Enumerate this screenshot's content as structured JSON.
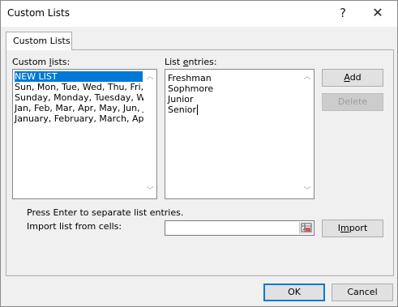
{
  "window": {
    "title": "Custom Lists",
    "help_glyph": "?",
    "close_glyph": "✕"
  },
  "tab": {
    "label": "Custom Lists"
  },
  "custom_lists": {
    "label_pre": "Custom ",
    "label_accel": "l",
    "label_post": "ists:",
    "items": [
      {
        "label": "NEW LIST",
        "selected": true
      },
      {
        "label": "Sun, Mon, Tue, Wed, Thu, Fri, S"
      },
      {
        "label": "Sunday, Monday, Tuesday, We"
      },
      {
        "label": "Jan, Feb, Mar, Apr, May, Jun, Ju"
      },
      {
        "label": "January, February, March, Apri"
      }
    ]
  },
  "list_entries": {
    "label_pre": "List ",
    "label_accel": "e",
    "label_post": "ntries:",
    "lines": [
      "Freshman",
      "Sophmore",
      "Junior",
      "Senior"
    ]
  },
  "buttons": {
    "add_accel": "A",
    "add_rest": "dd",
    "delete_label": "Delete",
    "import_pre": "I",
    "import_accel": "m",
    "import_post": "port",
    "ok_label": "OK",
    "cancel_label": "Cancel"
  },
  "hint": "Press Enter to separate list entries.",
  "import_label": "Import list from cells:",
  "colors": {
    "selection": "#0078d7",
    "default_button_border": "#0078d7"
  }
}
